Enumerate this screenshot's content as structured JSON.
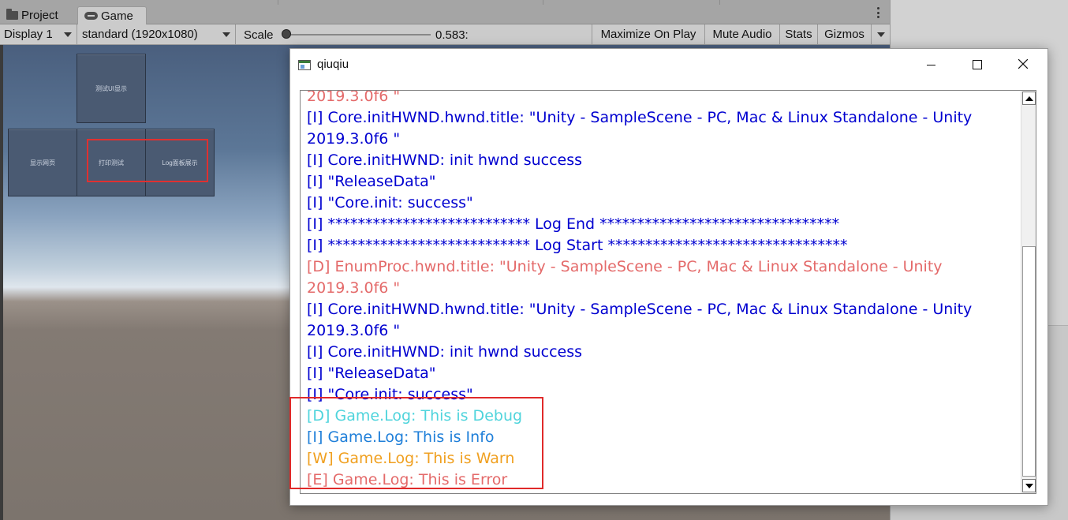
{
  "tabs": [
    {
      "label": "Project",
      "icon": "folder-icon"
    },
    {
      "label": "Game",
      "icon": "gamepad-icon",
      "active": true
    }
  ],
  "toolbar": {
    "display": "Display 1",
    "resolution": "standard (1920x1080)",
    "scale_label": "Scale",
    "scale_value": "0.583:",
    "maximize": "Maximize On Play",
    "mute": "Mute Audio",
    "stats": "Stats",
    "gizmos": "Gizmos"
  },
  "game_buttons": {
    "top": "测试UI显示",
    "left": "显示网页",
    "middle": "打印测试",
    "right": "Log面板展示"
  },
  "window": {
    "title": "qiuqiu"
  },
  "log": [
    {
      "level": "d",
      "text": "2019.3.0f6 \""
    },
    {
      "level": "i",
      "text": "[I] Core.initHWND.hwnd.title: \"Unity - SampleScene - PC, Mac & Linux Standalone - Unity"
    },
    {
      "level": "i",
      "text": "2019.3.0f6 \""
    },
    {
      "level": "i",
      "text": "[I] Core.initHWND: init hwnd success"
    },
    {
      "level": "i",
      "text": "[I] \"ReleaseData\""
    },
    {
      "level": "i",
      "text": "[I] \"Core.init: success\""
    },
    {
      "level": "i",
      "text": "[I] *************************** Log End ********************************"
    },
    {
      "level": "i",
      "text": "[I] *************************** Log Start ********************************"
    },
    {
      "level": "d",
      "text": "[D] EnumProc.hwnd.title: \"Unity - SampleScene - PC, Mac & Linux Standalone - Unity"
    },
    {
      "level": "d",
      "text": "2019.3.0f6 \""
    },
    {
      "level": "i",
      "text": "[I] Core.initHWND.hwnd.title: \"Unity - SampleScene - PC, Mac & Linux Standalone - Unity"
    },
    {
      "level": "i",
      "text": "2019.3.0f6 \""
    },
    {
      "level": "i",
      "text": "[I] Core.initHWND: init hwnd success"
    },
    {
      "level": "i",
      "text": "[I] \"ReleaseData\""
    },
    {
      "level": "i",
      "text": "[I] \"Core.init: success\""
    },
    {
      "level": "gd",
      "text": "[D] Game.Log: This is Debug"
    },
    {
      "level": "gi",
      "text": "[I] Game.Log: This is Info"
    },
    {
      "level": "gw",
      "text": "[W] Game.Log: This is Warn"
    },
    {
      "level": "ge",
      "text": "[E] Game.Log: This is Error"
    }
  ],
  "colors": {
    "info": "#0000d0",
    "debug": "#e46a6a",
    "game_debug": "#4fd4dc",
    "game_info": "#1f7fd9",
    "game_warn": "#f0a020",
    "game_error": "#e46a6a",
    "highlight": "#e02a2a"
  }
}
